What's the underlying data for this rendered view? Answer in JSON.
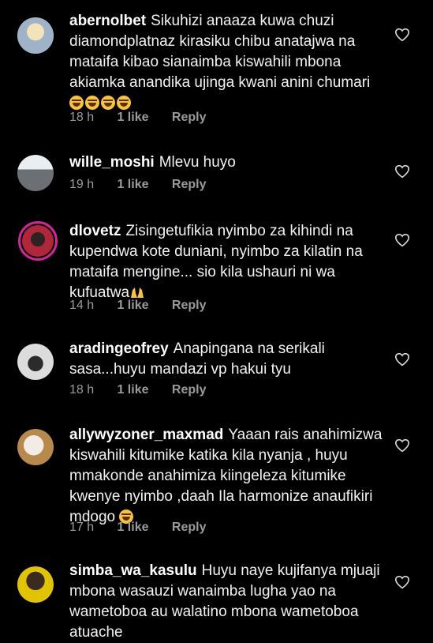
{
  "comments": [
    {
      "username": "abernolbet",
      "text": "Sikuhizi anaaza kuwa chuzi diamondplatnaz kirasiku chibu anatajwa na mataifa kibao sianaimba kiswahili mbona akiamka anandika ujinga kwani anini chumari",
      "emoji": "😂😂😂😂",
      "time": "18 h",
      "likes": "1 like",
      "reply": "Reply"
    },
    {
      "username": "wille_moshi",
      "text": "Mlevu huyo",
      "time": "19 h",
      "likes": "1 like",
      "reply": "Reply"
    },
    {
      "username": "dlovetz",
      "text": "Zisingetufikia nyimbo za kihindi na kupendwa kote duniani, nyimbo za kilatin na mataifa mengine... sio kila ushauri ni wa kufuatwa",
      "emoji": "🙌",
      "time": "14 h",
      "likes": "1 like",
      "reply": "Reply"
    },
    {
      "username": "aradingeofrey",
      "text": "Anapingana na serikali sasa...huyu mandazi vp hakui tyu",
      "time": "18 h",
      "likes": "1 like",
      "reply": "Reply"
    },
    {
      "username": "allywyzoner_maxmad",
      "text": "Yaaan rais anahimizwa kiswahili kitumike katika kila nyanja , huyu mmakonde anahimiza kiingeleza kitumike kwenye nyimbo ,daah Ila harmonize anaufikiri mdogo",
      "emoji": "😂",
      "time": "17 h",
      "likes": "1 like",
      "reply": "Reply"
    },
    {
      "username": "simba_wa_kasulu",
      "text": "Huyu naye kujifanya mjuaji mbona wasauzi wanaimba lugha yao na wametoboa au walatino mbona wametoboa atuache"
    }
  ],
  "colors": {
    "background": "#000000",
    "text": "#f2f2f2",
    "meta": "#9a9a9a",
    "story_ring": "#d6249f"
  }
}
